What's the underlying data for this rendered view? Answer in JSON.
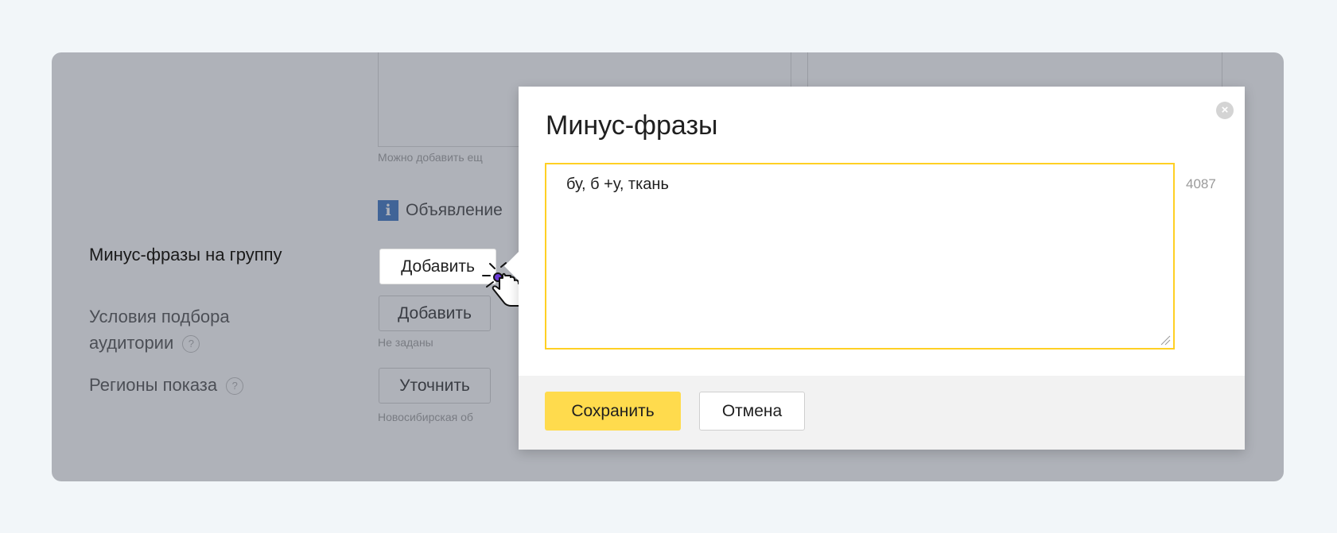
{
  "form": {
    "hint_more": "Можно добавить ещ",
    "info_text": "Объявление",
    "minus_phrases_label": "Минус-фразы на группу",
    "minus_phrases_button": "Добавить",
    "audience_label_line1": "Условия подбора",
    "audience_label_line2": "аудитории",
    "audience_button": "Добавить",
    "audience_hint": "Не заданы",
    "regions_label": "Регионы показа",
    "regions_button": "Уточнить",
    "regions_hint": "Новосибирская об",
    "help_mark": "?"
  },
  "modal": {
    "title": "Минус-фразы",
    "textarea_value": "бу, б +у, ткань",
    "char_count": "4087",
    "save_label": "Сохранить",
    "cancel_label": "Отмена"
  },
  "colors": {
    "accent": "#ffdb4d",
    "focus_border": "#ffd024",
    "info_badge": "#2f6dbf"
  }
}
